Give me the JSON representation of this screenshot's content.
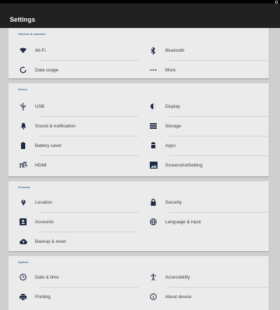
{
  "app": {
    "title": "Settings"
  },
  "colors": {
    "accent": "#1f2a44",
    "header": "#3d6f8e",
    "appbar": "#212121"
  },
  "sections": [
    {
      "header": "Wireless & networks",
      "items": [
        {
          "label": "Wi-Fi",
          "icon": "wifi-icon"
        },
        {
          "label": "Bluetooth",
          "icon": "bluetooth-icon"
        },
        {
          "label": "Data usage",
          "icon": "data-usage-icon"
        },
        {
          "label": "More",
          "icon": "more-icon"
        }
      ]
    },
    {
      "header": "Device",
      "items": [
        {
          "label": "USB",
          "icon": "usb-icon"
        },
        {
          "label": "Display",
          "icon": "display-icon"
        },
        {
          "label": "Sound & notification",
          "icon": "bell-icon"
        },
        {
          "label": "Storage",
          "icon": "storage-icon"
        },
        {
          "label": "Battery saver",
          "icon": "battery-icon"
        },
        {
          "label": "Apps",
          "icon": "android-icon"
        },
        {
          "label": "HDMI",
          "icon": "hdmi-icon"
        },
        {
          "label": "ScreenshotSetting",
          "icon": "screenshot-icon"
        }
      ]
    },
    {
      "header": "Personal",
      "items": [
        {
          "label": "Location",
          "icon": "location-pin-icon"
        },
        {
          "label": "Security",
          "icon": "lock-icon"
        },
        {
          "label": "Accounts",
          "icon": "accounts-icon"
        },
        {
          "label": "Language & input",
          "icon": "globe-icon"
        },
        {
          "label": "Backup & reset",
          "icon": "cloud-upload-icon"
        }
      ]
    },
    {
      "header": "System",
      "items": [
        {
          "label": "Date & time",
          "icon": "clock-icon"
        },
        {
          "label": "Accessibility",
          "icon": "accessibility-icon"
        },
        {
          "label": "Printing",
          "icon": "printer-icon"
        },
        {
          "label": "About device",
          "icon": "info-icon"
        }
      ]
    }
  ]
}
